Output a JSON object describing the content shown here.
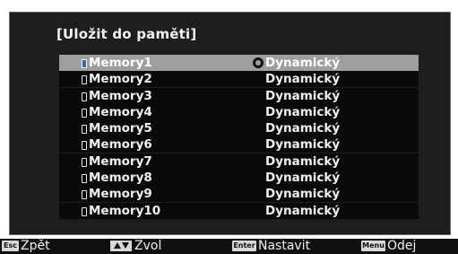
{
  "dialog": {
    "title": "[Uložit do paměti]"
  },
  "memories": [
    {
      "name": "Memory1",
      "mode": "Dynamický",
      "selected": true
    },
    {
      "name": "Memory2",
      "mode": "Dynamický",
      "selected": false
    },
    {
      "name": "Memory3",
      "mode": "Dynamický",
      "selected": false
    },
    {
      "name": "Memory4",
      "mode": "Dynamický",
      "selected": false
    },
    {
      "name": "Memory5",
      "mode": "Dynamický",
      "selected": false
    },
    {
      "name": "Memory6",
      "mode": "Dynamický",
      "selected": false
    },
    {
      "name": "Memory7",
      "mode": "Dynamický",
      "selected": false
    },
    {
      "name": "Memory8",
      "mode": "Dynamický",
      "selected": false
    },
    {
      "name": "Memory9",
      "mode": "Dynamický",
      "selected": false
    },
    {
      "name": "Memory10",
      "mode": "Dynamický",
      "selected": false
    }
  ],
  "footer": {
    "esc_key": "Esc",
    "esc_label": "Zpět",
    "select_label": "Zvol",
    "enter_key": "Enter",
    "enter_label": "Nastavit",
    "menu_key": "Menu",
    "menu_label": "Odej"
  },
  "colors": {
    "panel": "#1e1e1e",
    "highlight": "#9e9e9e",
    "row": "#0a0a0a"
  }
}
